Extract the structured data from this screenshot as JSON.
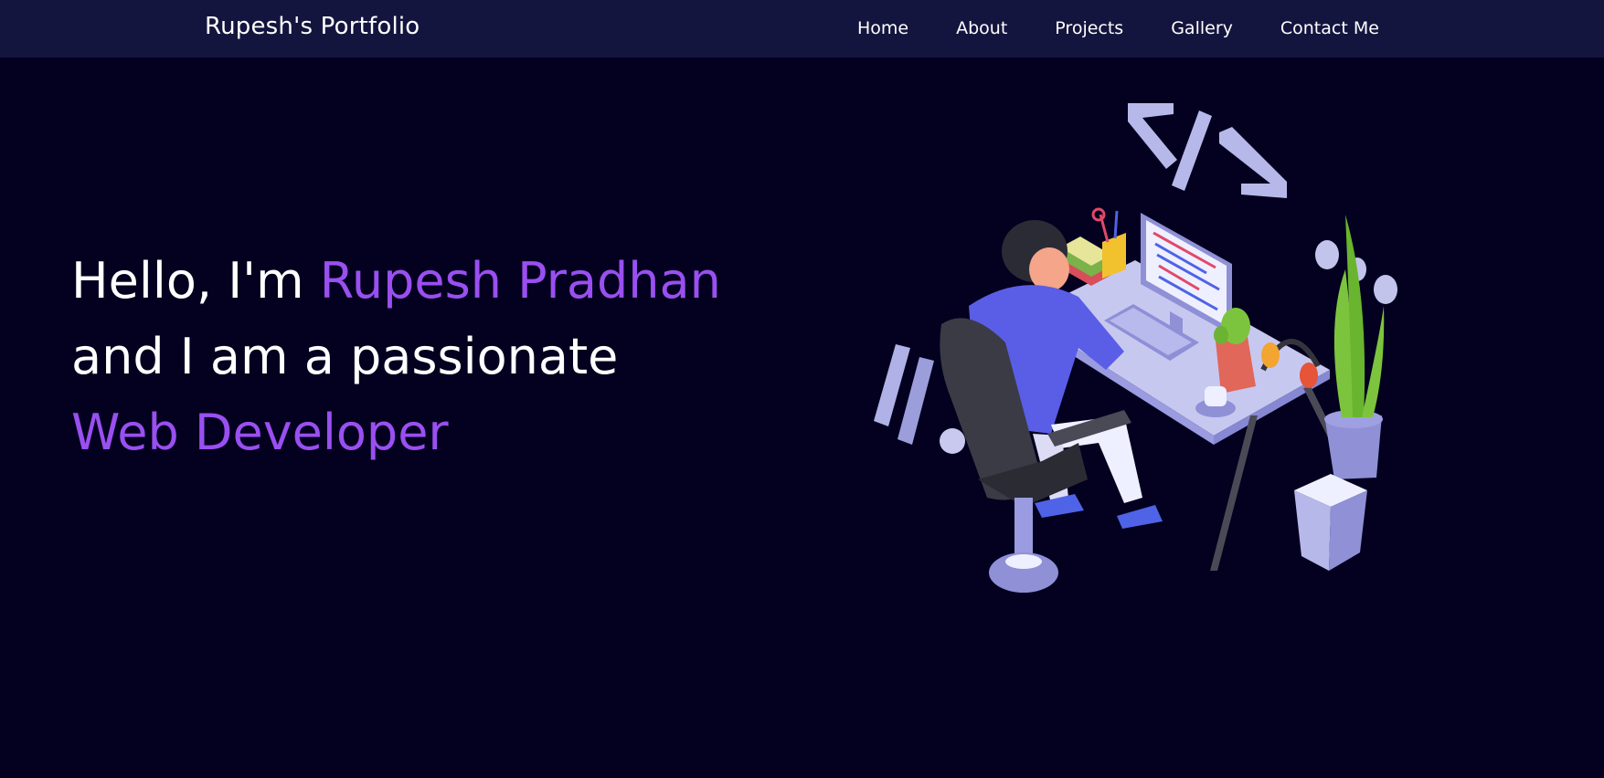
{
  "navbar": {
    "brand": "Rupesh's Portfolio",
    "links": [
      {
        "label": "Home"
      },
      {
        "label": "About"
      },
      {
        "label": "Projects"
      },
      {
        "label": "Gallery"
      },
      {
        "label": "Contact Me"
      }
    ]
  },
  "hero": {
    "greeting": "Hello, I'm ",
    "name": "Rupesh Pradhan",
    "line2": "and I am a passionate",
    "role": "Web Developer"
  },
  "colors": {
    "background": "#03011f",
    "navbar": "#14153e",
    "accent": "#9a4ff0",
    "text": "#ffffff"
  },
  "illustration": {
    "icon": "developer-at-desk-illustration",
    "code_symbol": "</>"
  }
}
